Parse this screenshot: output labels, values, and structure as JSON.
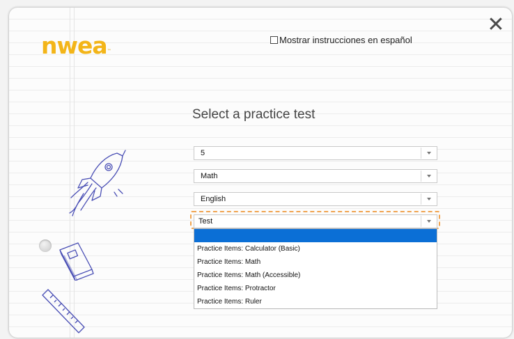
{
  "header": {
    "logo_text": "nwea",
    "logo_mark": "™",
    "spanish_label": "Mostrar instrucciones en español",
    "close_icon": "close-icon"
  },
  "main": {
    "title": "Select a practice test",
    "selects": [
      {
        "value": "5"
      },
      {
        "value": "Math"
      },
      {
        "value": "English"
      },
      {
        "value": "Test"
      }
    ],
    "dropdown": {
      "options": [
        "",
        "Practice Items: Calculator (Basic)",
        "Practice Items: Math",
        "Practice Items: Math (Accessible)",
        "Practice Items: Protractor",
        "Practice Items: Ruler"
      ],
      "highlight_color": "#0b6fd6"
    }
  },
  "colors": {
    "brand": "#f3b519",
    "focus_outline": "#f0a450",
    "doodle": "#4a4fb5"
  },
  "decor": [
    "rocket-doodle",
    "book-doodle",
    "ruler-doodle",
    "binder-hole"
  ]
}
